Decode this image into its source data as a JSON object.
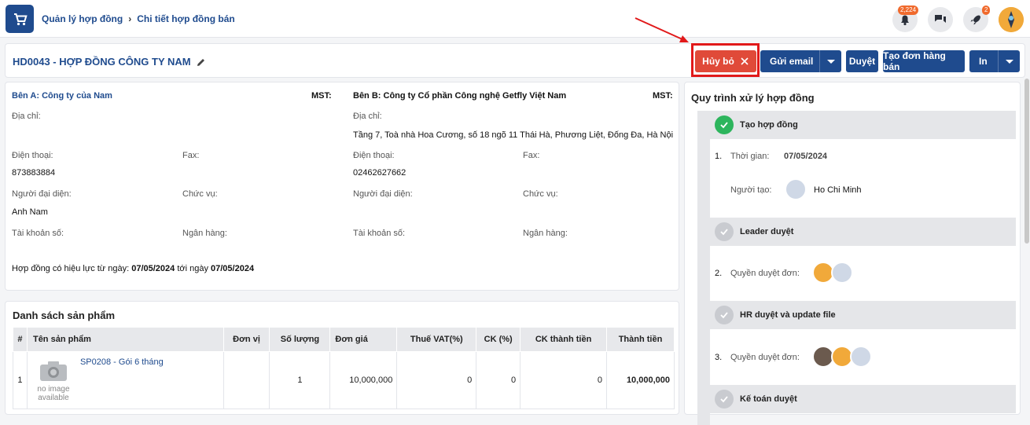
{
  "breadcrumb": {
    "parent": "Quản lý hợp đồng",
    "current": "Chi tiết hợp đồng bán"
  },
  "header": {
    "notifications_count": "2,224",
    "rocket_count": "2"
  },
  "contract": {
    "title": "HD0043 - HỢP ĐỒNG CÔNG TY NAM"
  },
  "actions": {
    "cancel": "Hủy bỏ",
    "send_email": "Gửi email",
    "approve": "Duyệt",
    "create_order": "Tạo đơn hàng bán",
    "print": "In"
  },
  "party_a": {
    "heading": "Bên A: Công ty của Nam",
    "mst_label": "MST:",
    "address_label": "Địa chỉ:",
    "address": "",
    "phone_label": "Điện thoại:",
    "phone": "873883884",
    "fax_label": "Fax:",
    "rep_label": "Người đại diện:",
    "rep": "Anh Nam",
    "position_label": "Chức vụ:",
    "account_label": "Tài khoản số:",
    "bank_label": "Ngân hàng:"
  },
  "party_b": {
    "heading": "Bên B: Công ty Cổ phần Công nghệ Getfly Việt Nam",
    "mst_label": "MST:",
    "address_label": "Địa chỉ:",
    "address": "Tầng 7, Toà nhà Hoa Cương, số 18 ngõ 11 Thái Hà, Phương Liệt, Đống Đa, Hà Nội",
    "phone_label": "Điện thoại:",
    "phone": "02462627662",
    "fax_label": "Fax:",
    "rep_label": "Người đại diện:",
    "position_label": "Chức vụ:",
    "account_label": "Tài khoản số:",
    "bank_label": "Ngân hàng:"
  },
  "validity": {
    "prefix": "Hợp đồng có hiệu lực từ ngày:",
    "from": "07/05/2024",
    "mid": "tới ngày",
    "to": "07/05/2024"
  },
  "products": {
    "title": "Danh sách sản phẩm",
    "columns": [
      "#",
      "Tên sản phẩm",
      "Đơn vị",
      "Số lượng",
      "Đơn giá",
      "Thuế VAT(%)",
      "CK (%)",
      "CK thành tiền",
      "Thành tiền"
    ],
    "rows": [
      {
        "index": "1",
        "name": "SP0208 - Gói 6 tháng",
        "no_image": "no image available",
        "unit": "",
        "qty": "1",
        "price": "10,000,000",
        "vat": "0",
        "ck": "0",
        "ck_amount": "0",
        "total": "10,000,000"
      }
    ]
  },
  "workflow": {
    "title": "Quy trình xử lý hợp đồng",
    "steps": [
      {
        "name": "Tạo hợp đồng",
        "index": "1.",
        "time_label": "Thời gian:",
        "time": "07/05/2024",
        "creator_label": "Người tạo:",
        "creator": "Ho Chi Minh"
      },
      {
        "name": "Leader duyệt",
        "index": "2.",
        "perm_label": "Quyền duyệt đơn:"
      },
      {
        "name": "HR duyệt và update file",
        "index": "3.",
        "perm_label": "Quyền duyệt đơn:"
      },
      {
        "name": "Kế toán duyệt"
      }
    ]
  },
  "colors": {
    "primary": "#1f4b8e",
    "danger": "#e04a39",
    "success": "#2db55d",
    "highlight": "#e1191a"
  }
}
